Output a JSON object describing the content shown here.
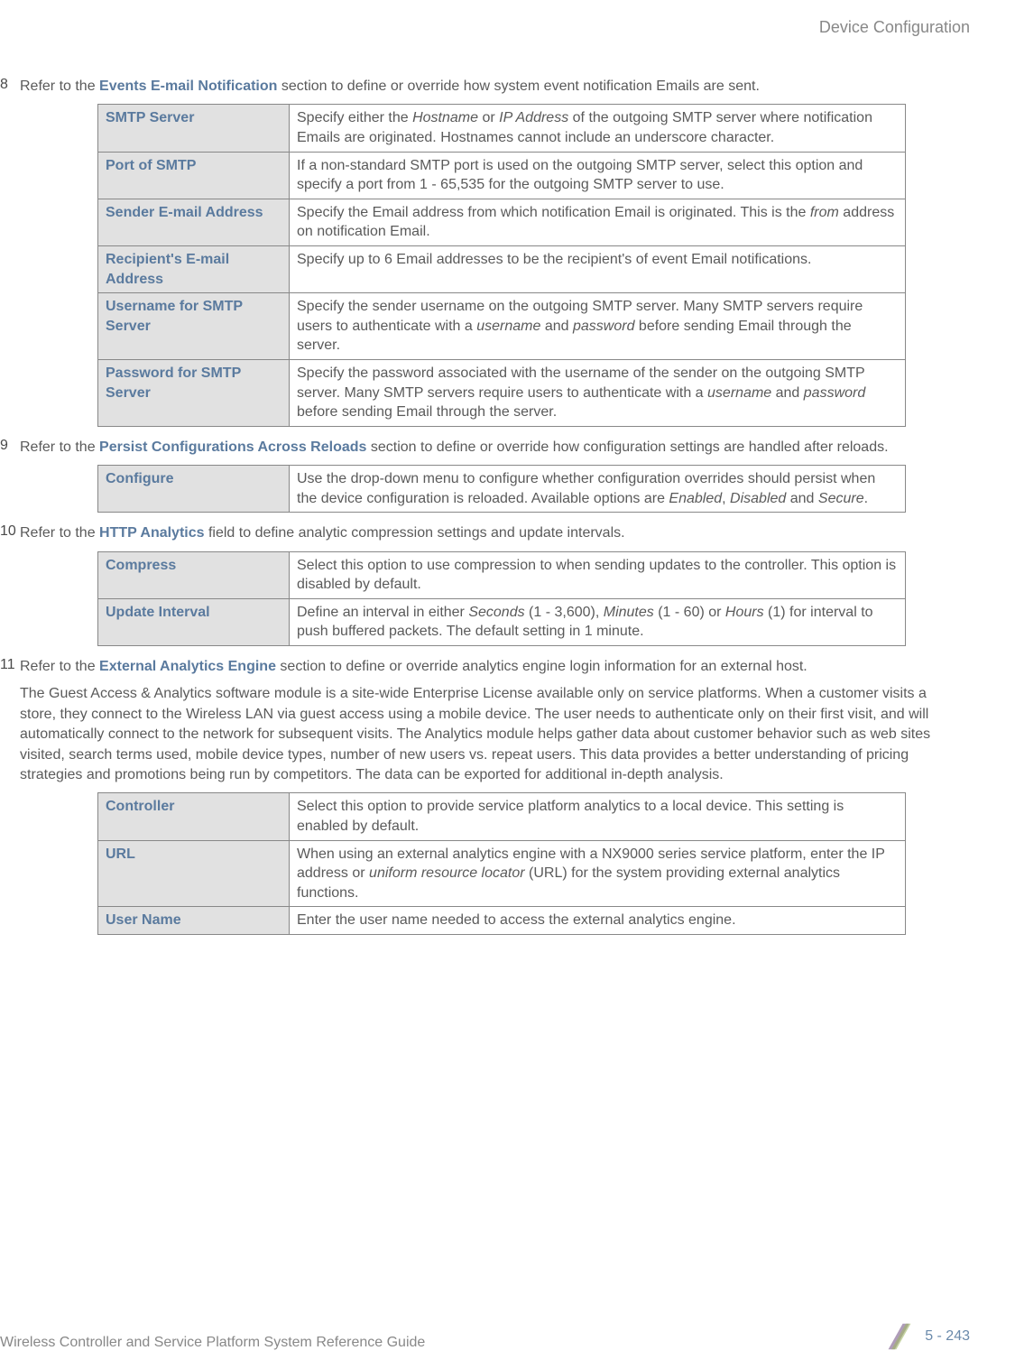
{
  "header": {
    "chapter": "Device Configuration"
  },
  "sections": [
    {
      "num": "8",
      "intro_pre": "Refer to the ",
      "intro_bold": "Events E-mail Notification",
      "intro_post": " section to define or override how system event notification Emails are sent.",
      "rows": [
        {
          "label": "SMTP Server",
          "desc": "Specify either the <i>Hostname</i> or <i>IP Address</i> of the outgoing SMTP server where notification Emails are originated. Hostnames cannot include an underscore character."
        },
        {
          "label": "Port of SMTP",
          "desc": "If a non-standard SMTP port is used on the outgoing SMTP server, select this option and specify a port from 1 - 65,535 for the outgoing SMTP server to use."
        },
        {
          "label": "Sender E-mail Address",
          "desc": "Specify the Email address from which notification Email is originated. This is the <i>from</i> address on notification Email."
        },
        {
          "label": "Recipient's E-mail Address",
          "desc": "Specify up to 6 Email addresses to be the recipient's of event Email notifications."
        },
        {
          "label": "Username for SMTP Server",
          "desc": "Specify the sender username on the outgoing SMTP server. Many SMTP servers require users to authenticate with a <i>username</i> and <i>password</i> before sending Email through the server."
        },
        {
          "label": "Password for SMTP Server",
          "desc": "Specify the password associated with the username of the sender on the outgoing SMTP server. Many SMTP servers require users to authenticate with a <i>username</i> and <i>password</i> before sending Email through the server."
        }
      ]
    },
    {
      "num": "9",
      "intro_pre": "Refer to the ",
      "intro_bold": "Persist Configurations Across Reloads",
      "intro_post": " section to define or override how configuration settings are handled after reloads.",
      "rows": [
        {
          "label": "Configure",
          "desc": "Use the drop-down menu to configure whether configuration overrides should persist when the device configuration is reloaded. Available options are <i>Enabled</i>, <i>Disabled</i> and <i>Secure</i>."
        }
      ]
    },
    {
      "num": "10",
      "intro_pre": "Refer to the ",
      "intro_bold": "HTTP Analytics",
      "intro_post": " field to define analytic compression settings and update intervals.",
      "rows": [
        {
          "label": "Compress",
          "desc": "Select this option to use compression to when sending updates to the controller. This option is disabled by default."
        },
        {
          "label": "Update Interval",
          "desc": "Define an interval in either <i>Seconds</i> (1 - 3,600), <i>Minutes</i> (1 - 60) or <i>Hours</i> (1) for interval to push buffered packets. The default setting in 1 minute."
        }
      ]
    },
    {
      "num": "11",
      "intro_pre": "Refer to the ",
      "intro_bold": "External Analytics Engine",
      "intro_post": " section to define or override analytics engine login information for an external host.",
      "paragraph": "The Guest Access & Analytics software module is a site-wide Enterprise License available only on service platforms. When a customer visits a store, they connect to the Wireless LAN via guest access using a mobile device. The user needs to authenticate only on their first visit, and will automatically connect to the network for subsequent visits. The Analytics module helps gather data about customer behavior such as web sites visited, search terms used, mobile device types, number of new users vs. repeat users. This data provides a better understanding of pricing strategies and promotions being run by competitors. The data can be exported for additional in-depth analysis.",
      "rows": [
        {
          "label": "Controller",
          "desc": "Select this option to provide service platform analytics to a local device. This setting is enabled by default."
        },
        {
          "label": "URL",
          "desc": "When using an external analytics engine with a NX9000 series service platform, enter the IP address or <i>uniform resource locator</i> (URL) for the system providing external analytics functions."
        },
        {
          "label": "User Name",
          "desc": "Enter the user name needed to access the external analytics engine."
        }
      ]
    }
  ],
  "footer": {
    "title": "Wireless Controller and Service Platform System Reference Guide",
    "page": "5 - 243"
  }
}
